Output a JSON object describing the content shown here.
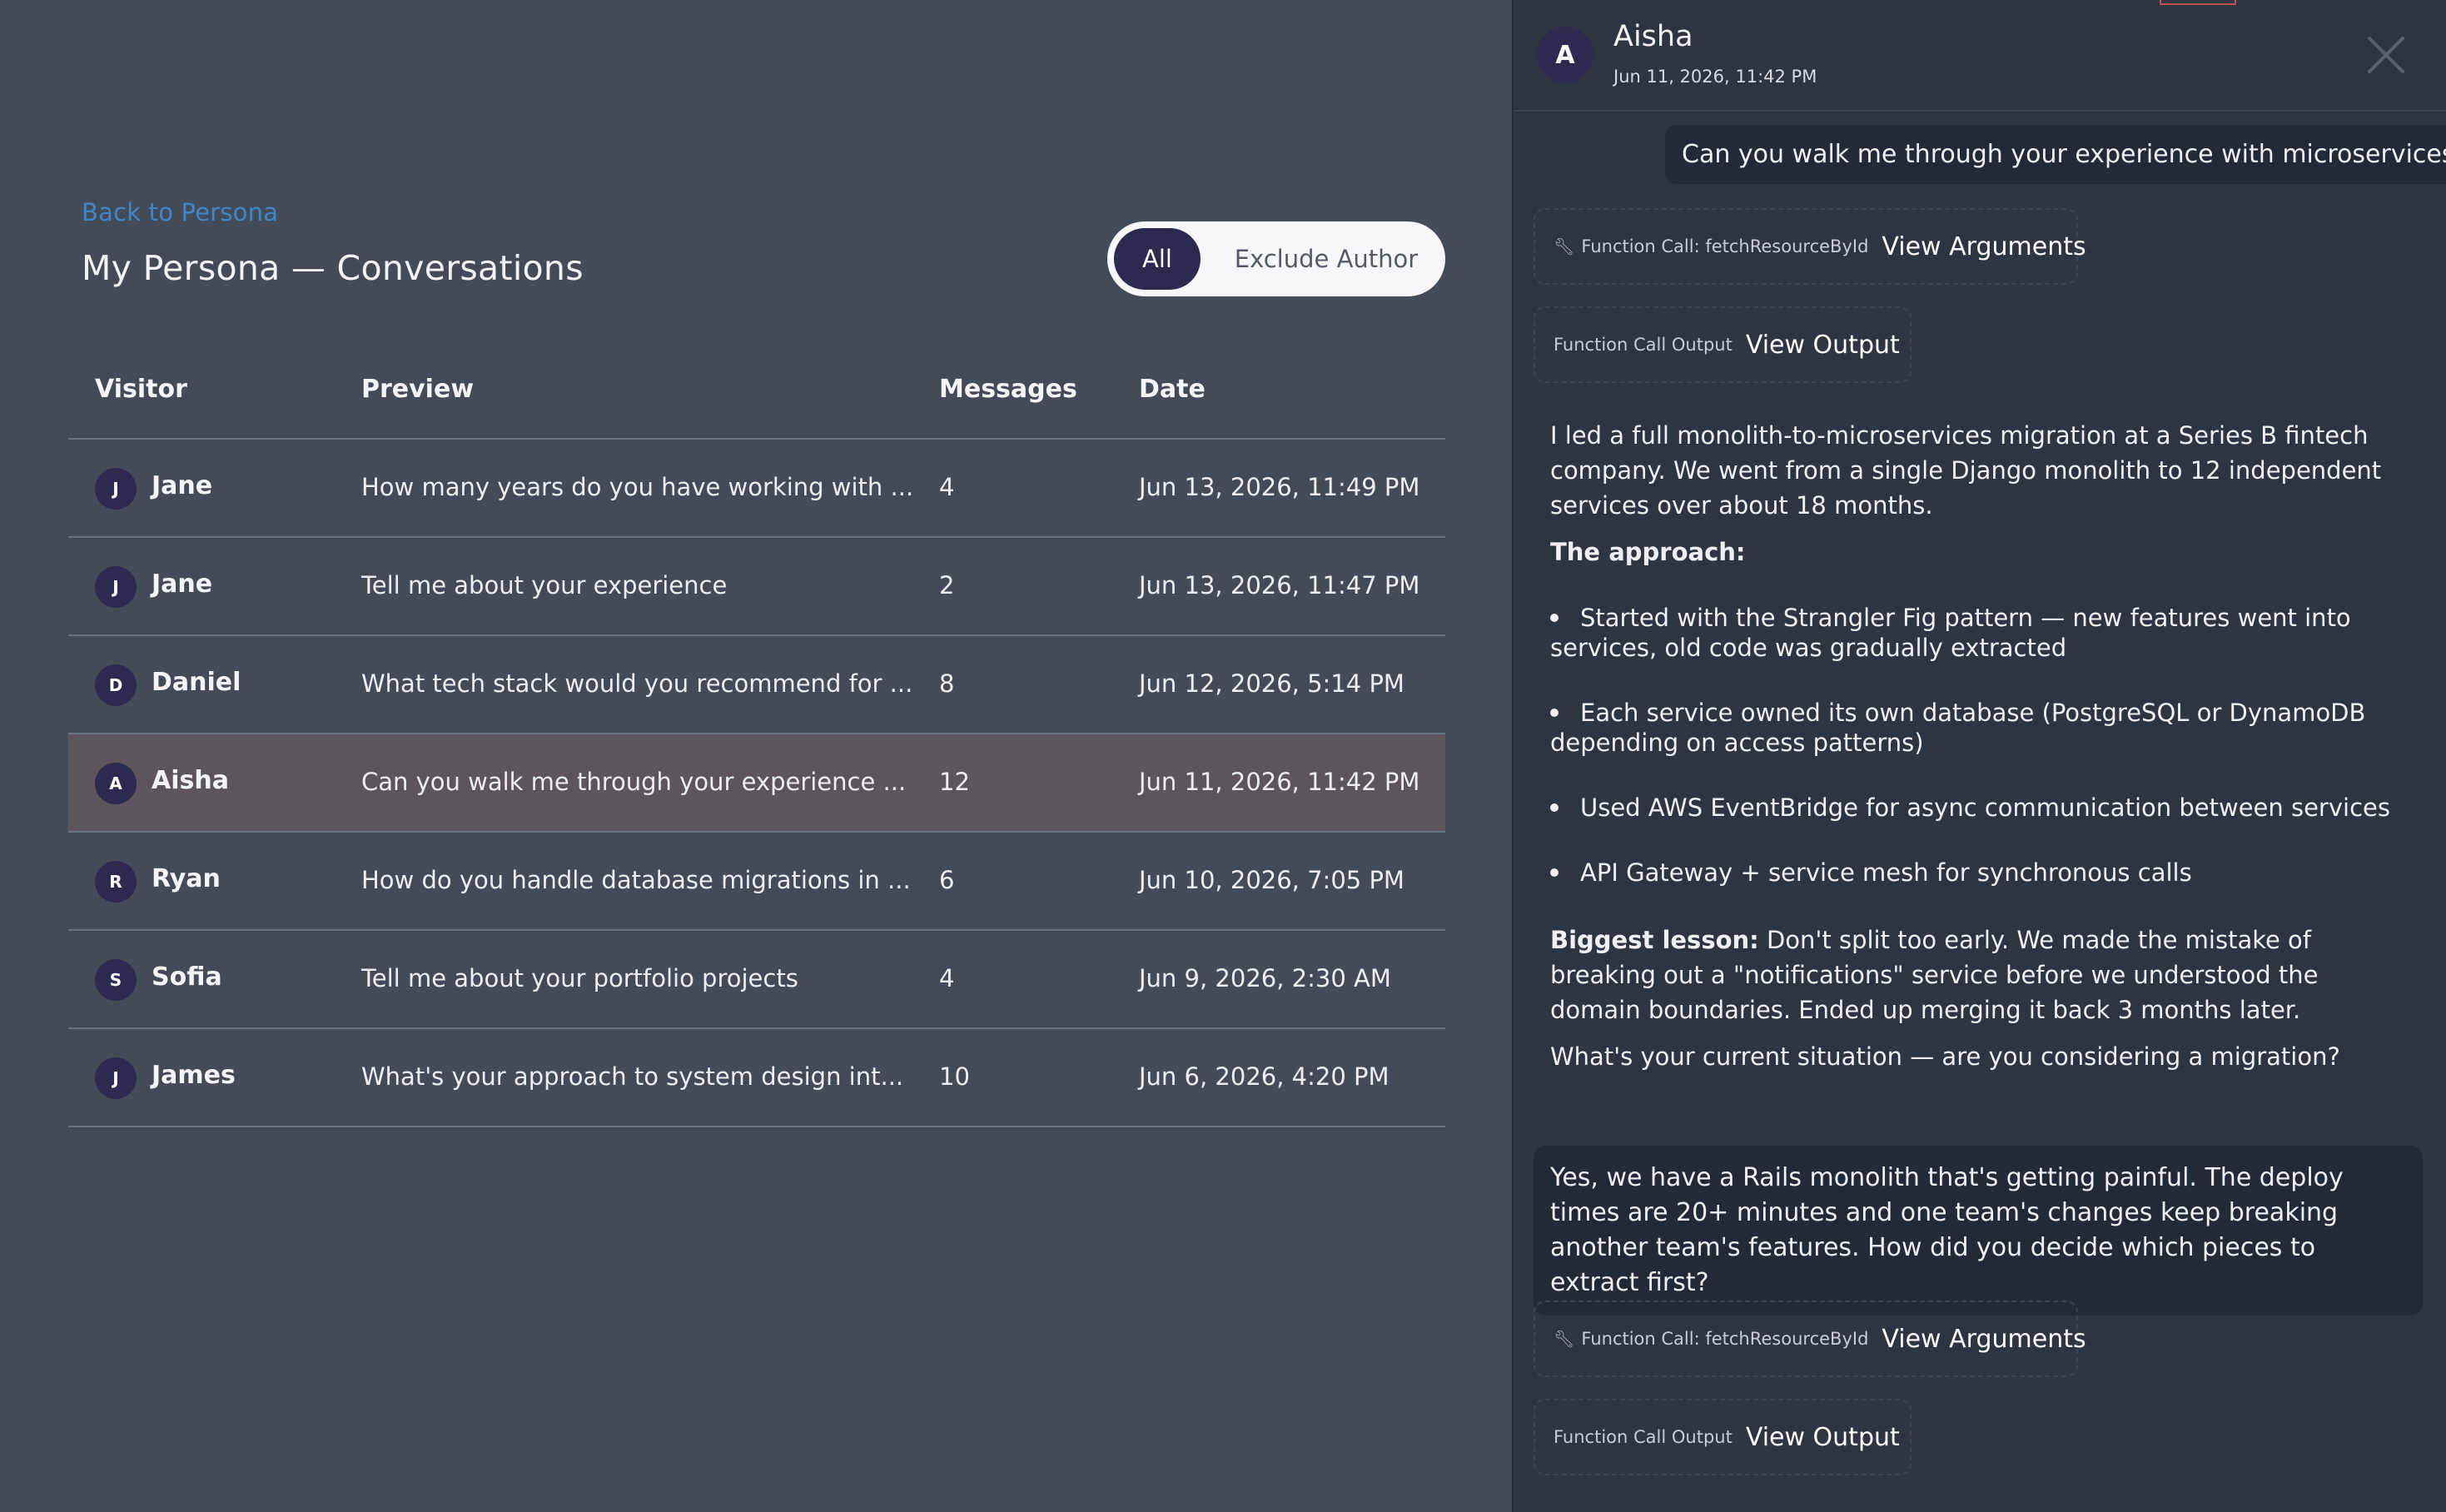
{
  "left": {
    "back_link": "Back to Persona",
    "title": "My Persona — Conversations",
    "filter": {
      "all": "All",
      "exclude_author": "Exclude Author",
      "selected": "All"
    },
    "columns": {
      "visitor": "Visitor",
      "preview": "Preview",
      "messages": "Messages",
      "date": "Date"
    },
    "rows": [
      {
        "initial": "J",
        "name": "Jane",
        "preview": "How many years do you have working with ...",
        "messages": "4",
        "date": "Jun 13, 2026, 11:49 PM"
      },
      {
        "initial": "J",
        "name": "Jane",
        "preview": "Tell me about your experience",
        "messages": "2",
        "date": "Jun 13, 2026, 11:47 PM"
      },
      {
        "initial": "D",
        "name": "Daniel",
        "preview": "What tech stack would you recommend for ...",
        "messages": "8",
        "date": "Jun 12, 2026, 5:14 PM"
      },
      {
        "initial": "A",
        "name": "Aisha",
        "preview": "Can you walk me through your experience ...",
        "messages": "12",
        "date": "Jun 11, 2026, 11:42 PM"
      },
      {
        "initial": "R",
        "name": "Ryan",
        "preview": "How do you handle database migrations in ...",
        "messages": "6",
        "date": "Jun 10, 2026, 7:05 PM"
      },
      {
        "initial": "S",
        "name": "Sofia",
        "preview": "Tell me about your portfolio projects",
        "messages": "4",
        "date": "Jun 9, 2026, 2:30 AM"
      },
      {
        "initial": "J",
        "name": "James",
        "preview": "What's your approach to system design int...",
        "messages": "10",
        "date": "Jun 6, 2026, 4:20 PM"
      }
    ]
  },
  "chat": {
    "avatar_initial": "A",
    "name": "Aisha",
    "date": "Jun 11, 2026, 11:42 PM",
    "user_msg_1": "Can you walk me through your experience with microservices?",
    "fn_call_label": "Function Call: fetchResourceById",
    "fn_call_action": "View Arguments",
    "fn_output_label": "Function Call Output",
    "fn_output_action": "View Output",
    "assistant": {
      "intro": "I led a full monolith-to-microservices migration at a Series B fintech company. We went from a single Django monolith to 12 independent services over about 18 months.",
      "approach_heading": "The approach:",
      "bullets": [
        "Started with the Strangler Fig pattern — new features went into services, old code was gradually extracted",
        "Each service owned its own database (PostgreSQL or DynamoDB depending on access patterns)",
        "Used AWS EventBridge for async communication between services",
        "API Gateway + service mesh for synchronous calls"
      ],
      "lesson_label": "Biggest lesson:",
      "lesson_text": "Don't split too early. We made the mistake of breaking out a \"notifications\" service before we understood the domain boundaries. Ended up merging it back 3 months later.",
      "question": "What's your current situation — are you considering a migration?"
    },
    "user_msg_2": "Yes, we have a Rails monolith that's getting painful. The deploy times are 20+ minutes and one team's changes keep breaking another team's features. How did you decide which pieces to extract first?"
  },
  "icons": {
    "close": "close-icon",
    "wrench": "wrench-icon"
  }
}
